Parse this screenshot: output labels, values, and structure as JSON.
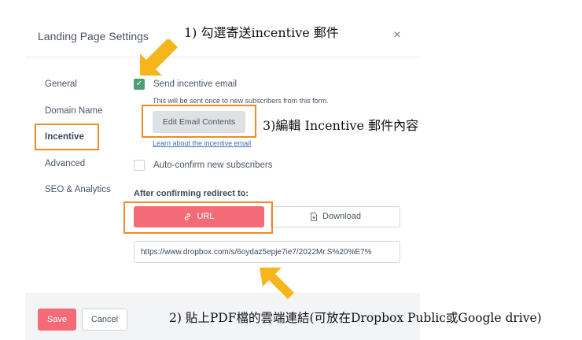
{
  "modal": {
    "title": "Landing Page Settings",
    "close_glyph": "×"
  },
  "nav": {
    "items": [
      {
        "label": "General"
      },
      {
        "label": "Domain Name"
      },
      {
        "label": "Incentive"
      },
      {
        "label": "Advanced"
      },
      {
        "label": "SEO & Analytics"
      }
    ]
  },
  "incentive": {
    "send_email_label": "Send incentive email",
    "send_email_checked": true,
    "helper_text": "This will be sent once to new subscribers from this form.",
    "edit_button": "Edit Email Contents",
    "learn_link": "Learn about the incentive email",
    "auto_confirm_label": "Auto-confirm new subscribers",
    "auto_confirm_checked": false
  },
  "redirect": {
    "label": "After confirming redirect to:",
    "url_option": "URL",
    "download_option": "Download",
    "selected": "URL",
    "url_value": "https://www.dropbox.com/s/6oydaz5epje7ie7/2022Mr.S%20%E7%"
  },
  "footer": {
    "save": "Save",
    "cancel": "Cancel"
  },
  "annotations": {
    "step1": "1) 勾選寄送incentive 郵件",
    "step2": "2) 貼上PDF檔的雲端連結(可放在Dropbox Public或Google drive)",
    "step3": "3)編輯 Incentive 郵件內容"
  },
  "colors": {
    "primary": "#f26b77",
    "check": "#4d9e78",
    "highlight": "#f08a24",
    "arrow": "#f5b51b",
    "link": "#3b6fb6"
  },
  "icons": {
    "link": "link-icon",
    "download": "file-download-icon",
    "check": "checkmark-icon",
    "close": "close-icon"
  }
}
